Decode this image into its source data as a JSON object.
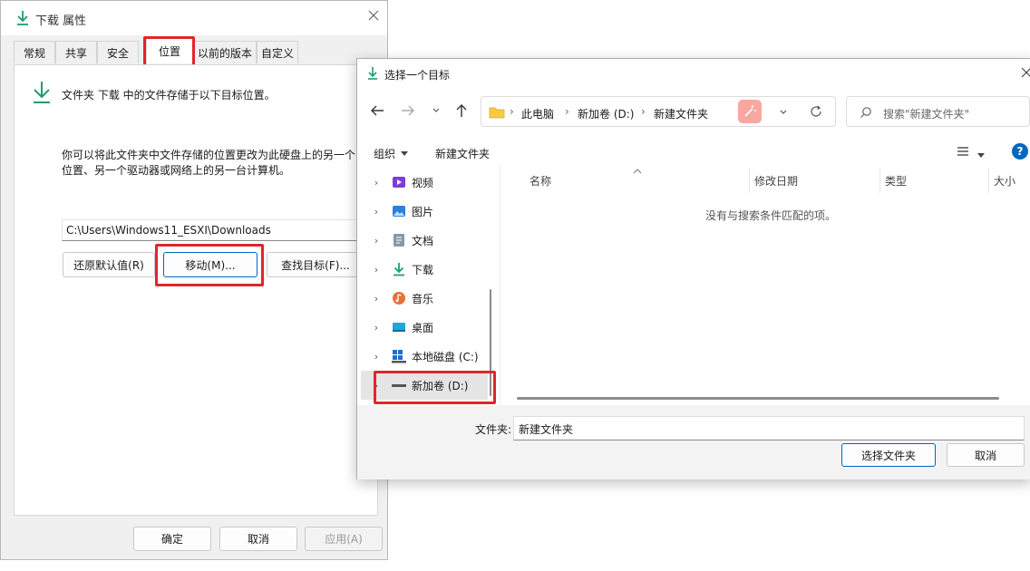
{
  "props_dialog": {
    "title": "下载 属性",
    "tabs": [
      "常规",
      "共享",
      "安全",
      "位置",
      "以前的版本",
      "自定义"
    ],
    "active_tab": "位置",
    "description": "文件夹 下载 中的文件存储于以下目标位置。",
    "info_line1": "你可以将此文件夹中文件存储的位置更改为此硬盘上的另一个",
    "info_line2": "位置、另一个驱动器或网络上的另一台计算机。",
    "path_value": "C:\\Users\\Windows11_ESXI\\Downloads",
    "restore_label": "还原默认值(R)",
    "move_label": "移动(M)...",
    "find_target_label": "查找目标(F)...",
    "ok_label": "确定",
    "cancel_label": "取消",
    "apply_label": "应用(A)"
  },
  "chooser": {
    "title": "选择一个目标",
    "breadcrumb": [
      "此电脑",
      "新加卷 (D:)",
      "新建文件夹"
    ],
    "search_placeholder": "搜索\"新建文件夹\"",
    "organize_label": "组织",
    "new_folder_label": "新建文件夹",
    "nav_items": [
      {
        "label": "视频",
        "icon": "video-folder-icon"
      },
      {
        "label": "图片",
        "icon": "pictures-folder-icon"
      },
      {
        "label": "文档",
        "icon": "documents-folder-icon"
      },
      {
        "label": "下载",
        "icon": "download-folder-icon"
      },
      {
        "label": "音乐",
        "icon": "music-folder-icon"
      },
      {
        "label": "桌面",
        "icon": "desktop-folder-icon"
      },
      {
        "label": "本地磁盘 (C:)",
        "icon": "windows-drive-icon"
      },
      {
        "label": "新加卷 (D:)",
        "icon": "drive-icon"
      }
    ],
    "selected_nav": "新加卷 (D:)",
    "columns": [
      "名称",
      "修改日期",
      "类型",
      "大小"
    ],
    "empty_message": "没有与搜索条件匹配的项。",
    "folder_label": "文件夹:",
    "folder_value": "新建文件夹",
    "select_folder_label": "选择文件夹",
    "cancel_label": "取消"
  },
  "colors": {
    "highlight": "#e0262b",
    "accent": "#0067c0",
    "download_green": "#1e9e6e"
  }
}
